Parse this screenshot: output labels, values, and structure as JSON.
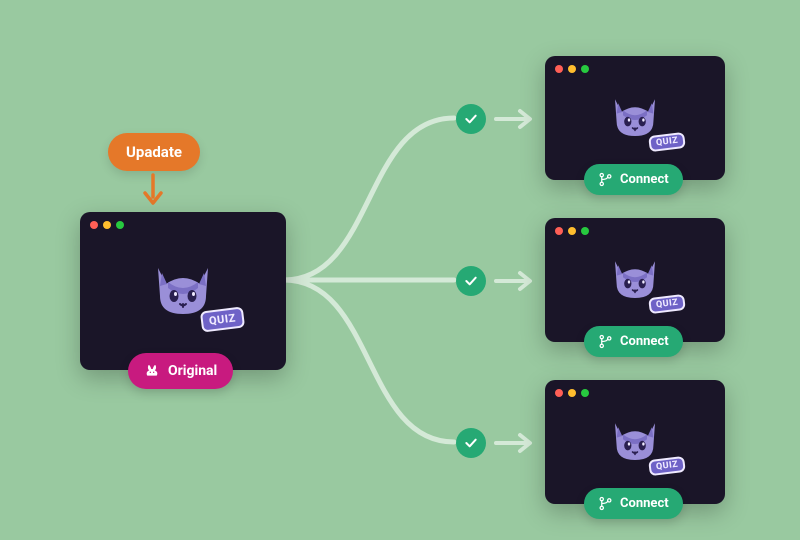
{
  "colors": {
    "bg": "#99c9a0",
    "window": "#1a1528",
    "update": "#e57829",
    "original": "#c81a7f",
    "accent": "#26a974",
    "cat": "#9a8fd8",
    "quiz_chip_bg": "#6e62c7",
    "quiz_chip_fg": "#efeaff",
    "arrow": "#d4e9d7",
    "orange_arrow": "#e57829"
  },
  "source": {
    "update_label": "Upadate",
    "original_label": "Original",
    "quiz_label": "QUIZ"
  },
  "targets": [
    {
      "quiz_label": "QUIZ",
      "connect_label": "Connect"
    },
    {
      "quiz_label": "QUIZ",
      "connect_label": "Connect"
    },
    {
      "quiz_label": "QUIZ",
      "connect_label": "Connect"
    }
  ],
  "icons": {
    "rabbit": "rabbit-icon",
    "branch": "branch-icon",
    "check": "check-icon",
    "arrow_right": "arrow-right-icon",
    "arrow_down": "arrow-down-icon",
    "cat": "cat-icon"
  }
}
